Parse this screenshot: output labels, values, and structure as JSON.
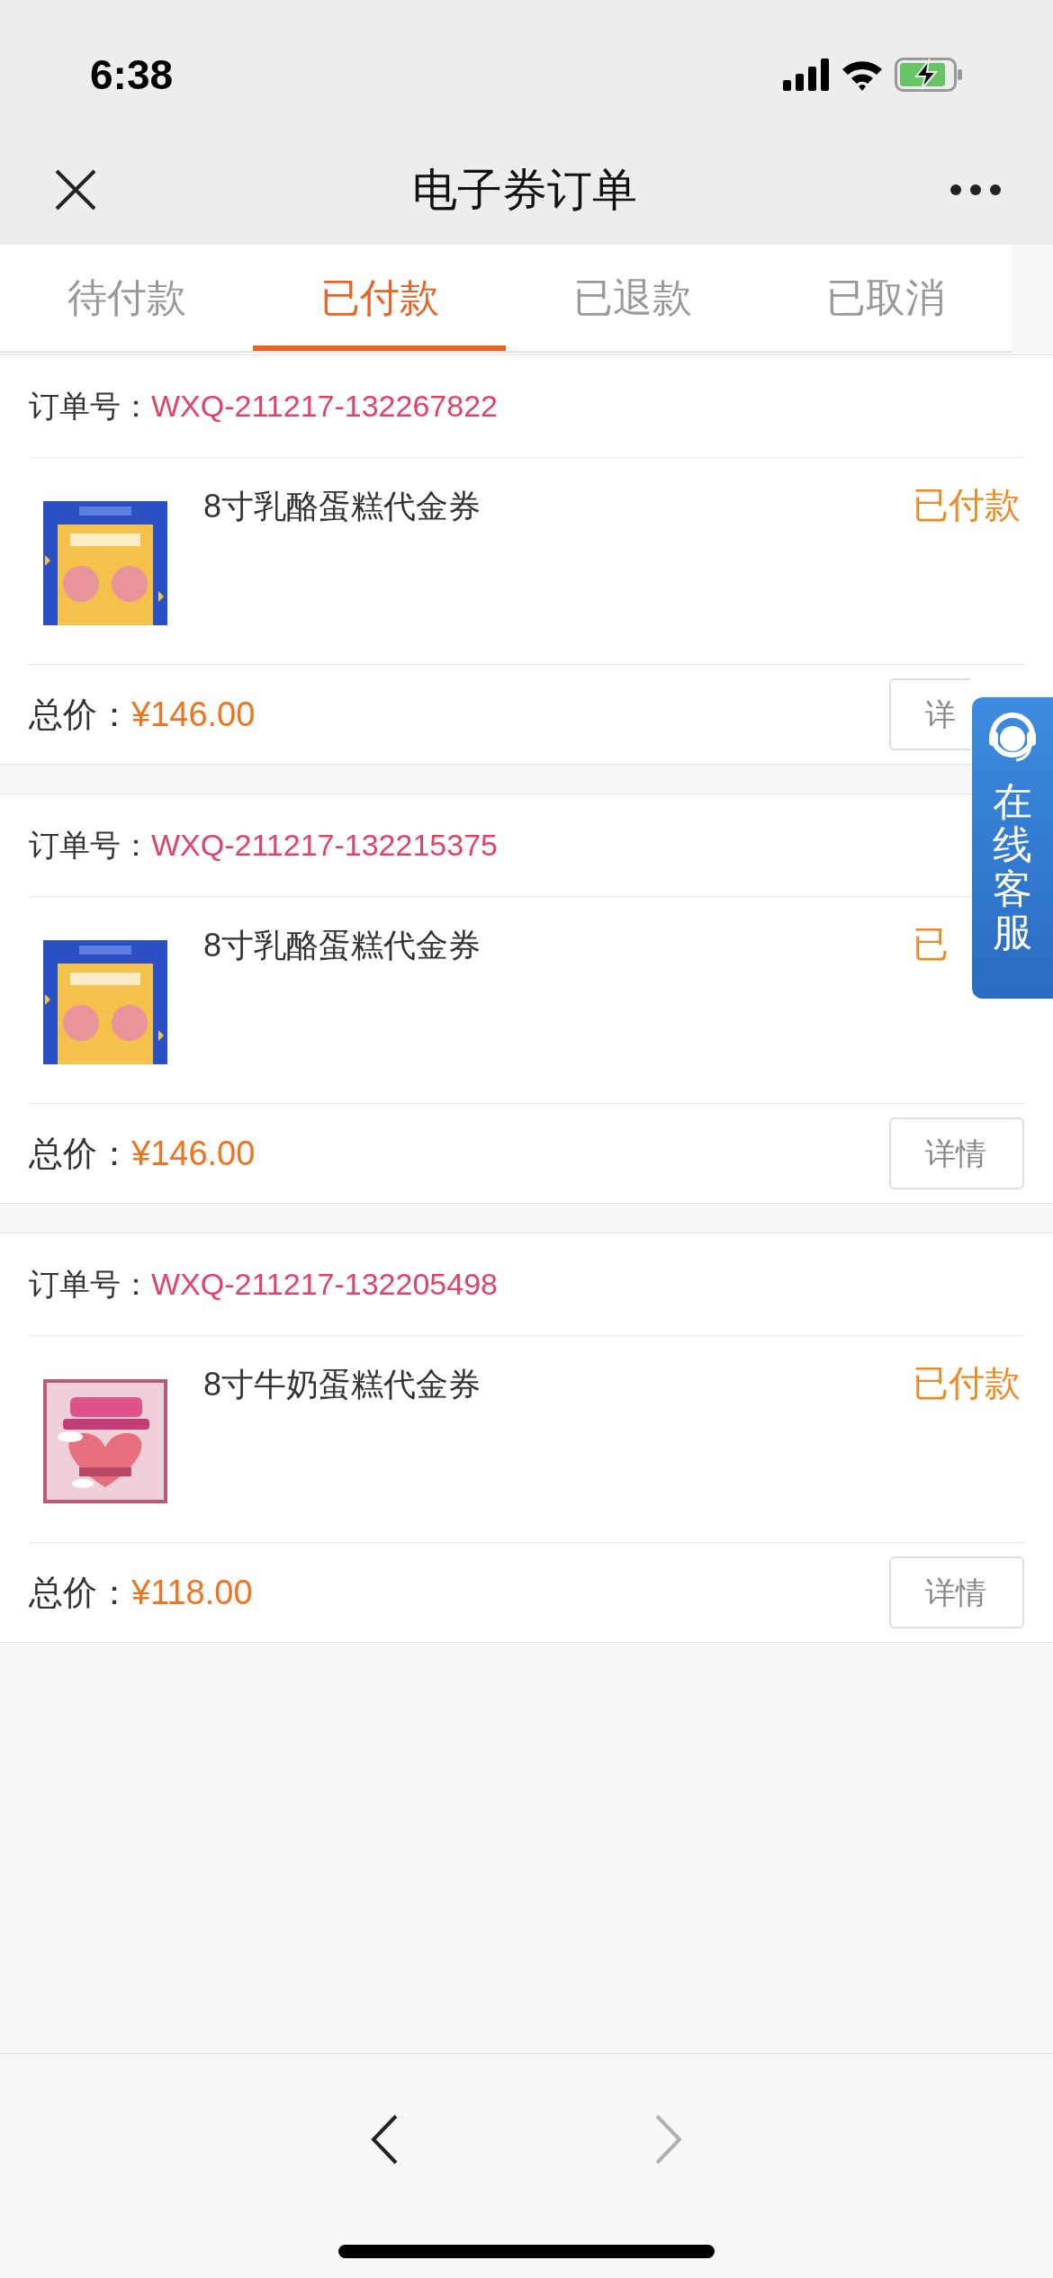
{
  "status_bar": {
    "time": "6:38"
  },
  "nav": {
    "title": "电子券订单"
  },
  "tabs": [
    {
      "label": "待付款",
      "selected": false
    },
    {
      "label": "已付款",
      "selected": true
    },
    {
      "label": "已退款",
      "selected": false
    },
    {
      "label": "已取消",
      "selected": false
    }
  ],
  "orders": [
    {
      "order_label": "订单号：",
      "order_no": "WXQ-211217-132267822",
      "product": "8寸乳酪蛋糕代金券",
      "status": "已付款",
      "total_label": "总价：",
      "total": "¥146.00",
      "button": "详"
    },
    {
      "order_label": "订单号：",
      "order_no": "WXQ-211217-132215375",
      "product": "8寸乳酪蛋糕代金券",
      "status": "已",
      "total_label": "总价：",
      "total": "¥146.00",
      "button": "详情"
    },
    {
      "order_label": "订单号：",
      "order_no": "WXQ-211217-132205498",
      "product": "8寸牛奶蛋糕代金券",
      "status": "已付款",
      "total_label": "总价：",
      "total": "¥118.00",
      "button": "详情"
    }
  ],
  "service": {
    "label": "在线客服"
  },
  "pager": {
    "prev": {
      "disabled": false
    },
    "next": {
      "disabled": true
    }
  }
}
